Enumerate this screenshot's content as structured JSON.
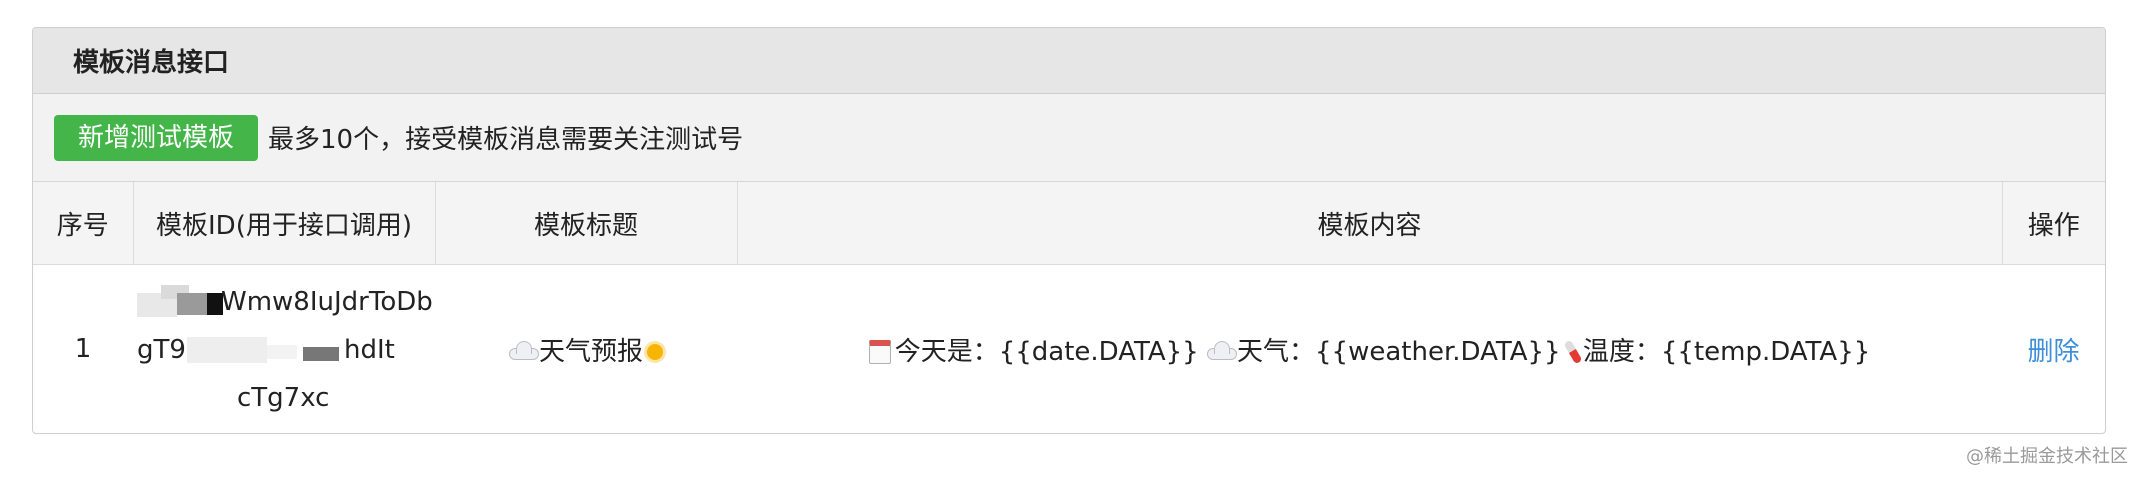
{
  "panel": {
    "title": "模板消息接口"
  },
  "toolbar": {
    "add_button_label": "新增测试模板",
    "note": "最多10个，接受模板消息需要关注测试号"
  },
  "table": {
    "headers": {
      "seq": "序号",
      "template_id": "模板ID(用于接口调用)",
      "title": "模板标题",
      "content": "模板内容",
      "action": "操作"
    },
    "rows": [
      {
        "seq": "1",
        "template_id_line1": "Wmw8IuJdrToDb",
        "template_id_line2a": "gT9L",
        "template_id_line2b": "hdIt",
        "template_id_line3": "cTg7xc",
        "title": "天气预报",
        "content_date": "今天是：{{date.DATA}}",
        "content_weather": "天气：{{weather.DATA}}",
        "content_temp": "温度：{{temp.DATA}}",
        "delete_label": "删除"
      }
    ]
  },
  "icons": {
    "cloud": "cloud-icon",
    "sun": "sun-icon",
    "calendar": "calendar-icon",
    "thermometer": "thermometer-icon"
  },
  "colors": {
    "add_button": "#44b549",
    "delete_link": "#3d8fd9"
  },
  "watermark": "@稀土掘金技术社区"
}
